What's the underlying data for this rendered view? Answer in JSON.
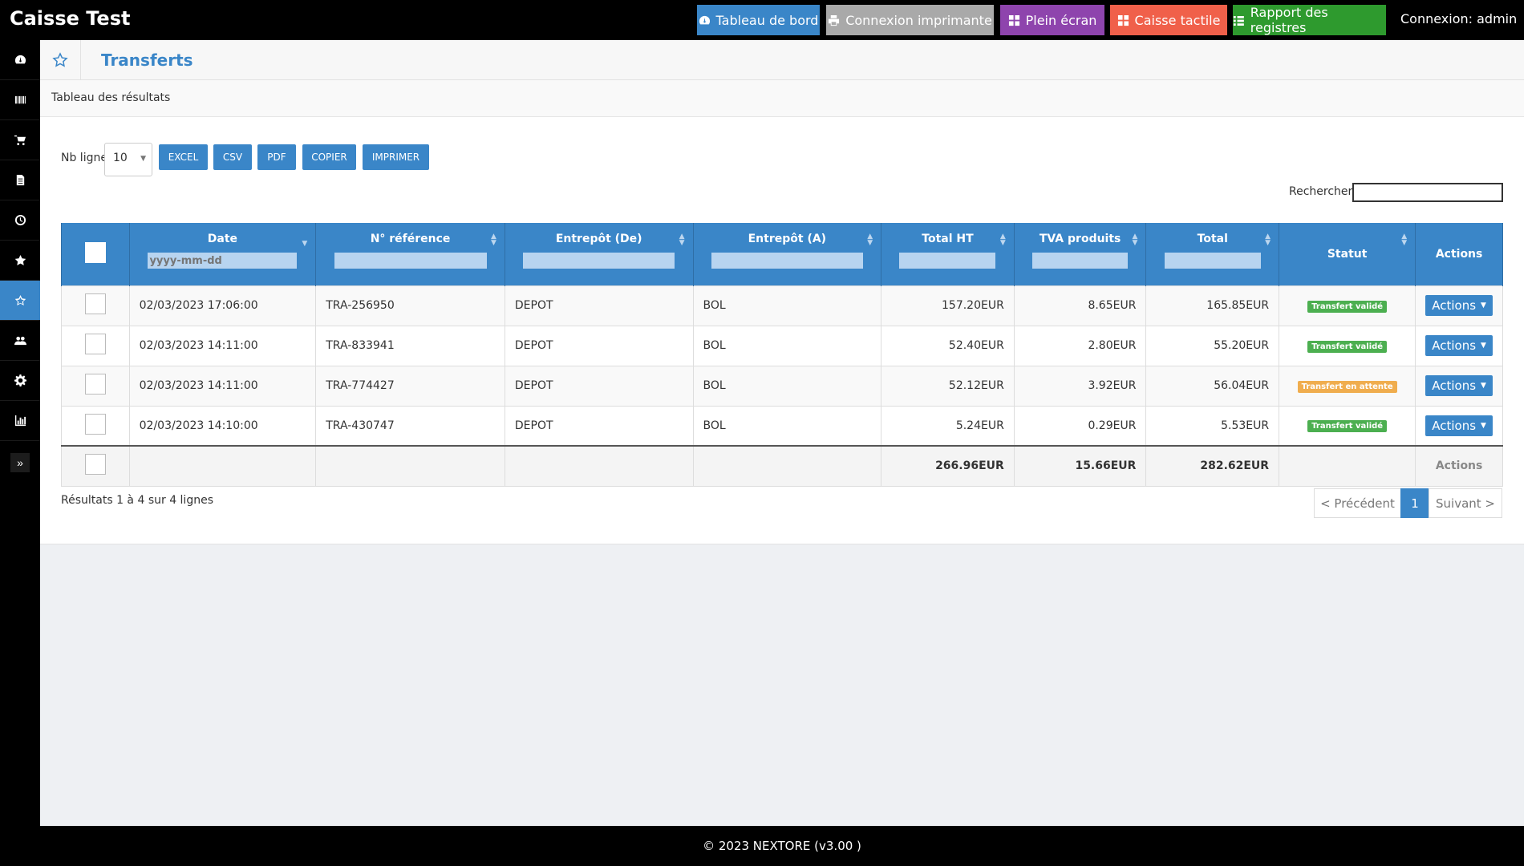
{
  "app": {
    "title": "Caisse Test",
    "connexion": "Connexion: admin"
  },
  "topbar": {
    "buttons": [
      {
        "label": "Tableau de bord",
        "icon": "dashboard-icon",
        "color": "#3a86c8"
      },
      {
        "label": "Connexion imprimante",
        "icon": "printer-icon",
        "color": "#a9a9a9"
      },
      {
        "label": "Plein écran",
        "icon": "grid-icon",
        "color": "#8e44ad"
      },
      {
        "label": "Caisse tactile",
        "icon": "grid-icon",
        "color": "#f0604a"
      },
      {
        "label": "Rapport des registres",
        "icon": "list-icon",
        "color": "#2e9a2e"
      }
    ]
  },
  "sidebar": {
    "items": [
      {
        "icon": "dashboard-icon"
      },
      {
        "icon": "barcode-icon"
      },
      {
        "icon": "cart-icon"
      },
      {
        "icon": "document-icon"
      },
      {
        "icon": "clock-icon"
      },
      {
        "icon": "star-icon"
      },
      {
        "icon": "star-outline-icon",
        "active": true
      },
      {
        "icon": "users-icon"
      },
      {
        "icon": "gear-icon"
      },
      {
        "icon": "bar-chart-icon"
      }
    ],
    "toggle": "»"
  },
  "page": {
    "title": "Transferts",
    "card_title": "Tableau des résultats"
  },
  "controls": {
    "nb_ligne_label": "Nb ligne",
    "nb_ligne_value": "10",
    "export_buttons": [
      "EXCEL",
      "CSV",
      "PDF",
      "COPIER",
      "IMPRIMER"
    ],
    "search_label": "Rechercher",
    "search_value": ""
  },
  "table": {
    "columns": [
      "Date",
      "N° référence",
      "Entrepôt (De)",
      "Entrepôt (A)",
      "Total HT",
      "TVA produits",
      "Total",
      "Statut",
      "Actions"
    ],
    "date_filter_placeholder": "yyyy-mm-dd",
    "rows": [
      {
        "date": "02/03/2023 17:06:00",
        "ref": "TRA-256950",
        "from": "DEPOT",
        "to": "BOL",
        "total_ht": "157.20EUR",
        "tva": "8.65EUR",
        "total": "165.85EUR",
        "status": "Transfert validé",
        "status_color": "#4caf50",
        "action": "Actions"
      },
      {
        "date": "02/03/2023 14:11:00",
        "ref": "TRA-833941",
        "from": "DEPOT",
        "to": "BOL",
        "total_ht": "52.40EUR",
        "tva": "2.80EUR",
        "total": "55.20EUR",
        "status": "Transfert validé",
        "status_color": "#4caf50",
        "action": "Actions"
      },
      {
        "date": "02/03/2023 14:11:00",
        "ref": "TRA-774427",
        "from": "DEPOT",
        "to": "BOL",
        "total_ht": "52.12EUR",
        "tva": "3.92EUR",
        "total": "56.04EUR",
        "status": "Transfert en attente",
        "status_color": "#f0ad4e",
        "action": "Actions"
      },
      {
        "date": "02/03/2023 14:10:00",
        "ref": "TRA-430747",
        "from": "DEPOT",
        "to": "BOL",
        "total_ht": "5.24EUR",
        "tva": "0.29EUR",
        "total": "5.53EUR",
        "status": "Transfert validé",
        "status_color": "#4caf50",
        "action": "Actions"
      }
    ],
    "footer": {
      "total_ht": "266.96EUR",
      "tva": "15.66EUR",
      "total": "282.62EUR",
      "actions": "Actions"
    }
  },
  "pagination": {
    "info": "Résultats 1 à 4 sur 4 lignes",
    "prev": "< Précédent",
    "current": "1",
    "next": "Suivant >"
  },
  "footer": {
    "text": "© 2023 NEXTORE (v3.00 )"
  }
}
